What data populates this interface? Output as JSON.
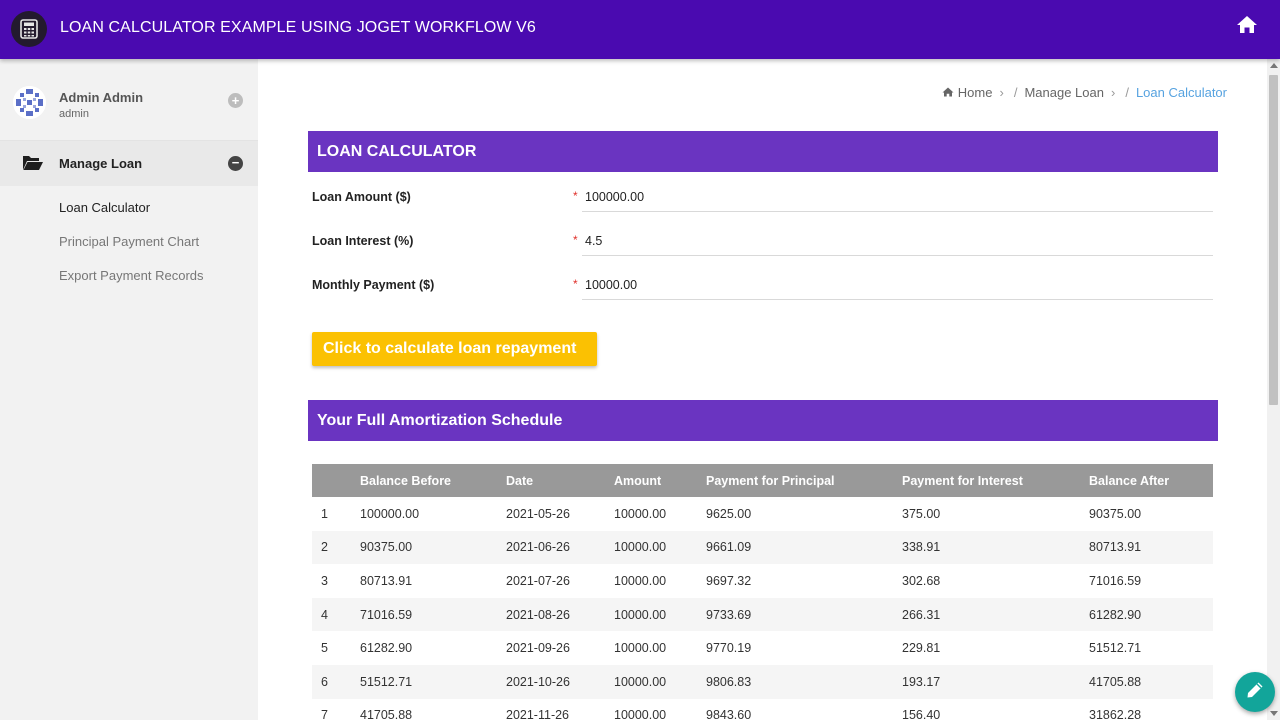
{
  "app": {
    "title": "LOAN CALCULATOR EXAMPLE USING JOGET WORKFLOW V6",
    "logo_icon": "calculator-icon",
    "home_icon": "home-icon",
    "accent_color": "#4a0ab0"
  },
  "user": {
    "name": "Admin Admin",
    "role": "admin",
    "toggle_symbol": "+"
  },
  "sidebar": {
    "group": {
      "label": "Manage Loan",
      "icon": "folder-open-icon",
      "collapse_symbol": "−"
    },
    "items": [
      {
        "label": "Loan Calculator",
        "active": true
      },
      {
        "label": "Principal Payment Chart",
        "active": false
      },
      {
        "label": "Export Payment Records",
        "active": false
      }
    ]
  },
  "breadcrumb": {
    "home": "Home",
    "section": "Manage Loan",
    "current": "Loan Calculator",
    "sep1": "›",
    "sep2": "/",
    "sep3": "›",
    "sep4": "/"
  },
  "form": {
    "header": "LOAN CALCULATOR",
    "required_mark": "*",
    "fields": [
      {
        "label": "Loan Amount ($)",
        "value": "100000.00"
      },
      {
        "label": "Loan Interest (%)",
        "value": "4.5"
      },
      {
        "label": "Monthly Payment ($)",
        "value": "10000.00"
      }
    ],
    "calculate_button": "Click to calculate loan repayment"
  },
  "schedule": {
    "header": "Your Full Amortization Schedule",
    "columns": [
      "",
      "Balance Before",
      "Date",
      "Amount",
      "Payment for Principal",
      "Payment for Interest",
      "Balance After"
    ],
    "rows": [
      [
        "1",
        "100000.00",
        "2021-05-26",
        "10000.00",
        "9625.00",
        "375.00",
        "90375.00"
      ],
      [
        "2",
        "90375.00",
        "2021-06-26",
        "10000.00",
        "9661.09",
        "338.91",
        "80713.91"
      ],
      [
        "3",
        "80713.91",
        "2021-07-26",
        "10000.00",
        "9697.32",
        "302.68",
        "71016.59"
      ],
      [
        "4",
        "71016.59",
        "2021-08-26",
        "10000.00",
        "9733.69",
        "266.31",
        "61282.90"
      ],
      [
        "5",
        "61282.90",
        "2021-09-26",
        "10000.00",
        "9770.19",
        "229.81",
        "51512.71"
      ],
      [
        "6",
        "51512.71",
        "2021-10-26",
        "10000.00",
        "9806.83",
        "193.17",
        "41705.88"
      ],
      [
        "7",
        "41705.88",
        "2021-11-26",
        "10000.00",
        "9843.60",
        "156.40",
        "31862.28"
      ]
    ]
  },
  "fab": {
    "icon": "pencil-icon"
  }
}
